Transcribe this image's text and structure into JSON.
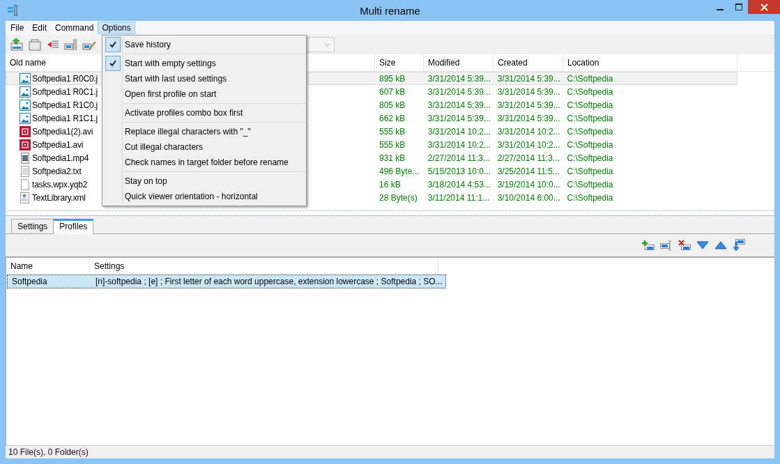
{
  "window": {
    "title": "Multi rename"
  },
  "menubar": [
    {
      "label": "File",
      "selected": false
    },
    {
      "label": "Edit",
      "selected": false
    },
    {
      "label": "Command",
      "selected": false
    },
    {
      "label": "Options",
      "selected": true
    }
  ],
  "options_menu": {
    "groups": [
      [
        {
          "label": "Save history",
          "checked": true
        }
      ],
      [
        {
          "label": "Start with empty settings",
          "checked": true
        },
        {
          "label": "Start with last used settings",
          "checked": false
        },
        {
          "label": "Open first profile on start",
          "checked": false
        }
      ],
      [
        {
          "label": "Activate profiles combo box first",
          "checked": false
        }
      ],
      [
        {
          "label": "Replace illegal characters with \"_\"",
          "checked": false
        },
        {
          "label": "Cut illegal characters",
          "checked": false
        },
        {
          "label": "Check names in target folder before rename",
          "checked": false
        }
      ],
      [
        {
          "label": "Stay on top",
          "checked": false
        },
        {
          "label": "Quick viewer orientation - horizontal",
          "checked": false
        }
      ]
    ]
  },
  "files": {
    "columns": [
      "Old name",
      "Size",
      "Modified",
      "Created",
      "Location"
    ],
    "rows": [
      {
        "kind": "image",
        "name": "Softpedia1 R0C0.j",
        "size": "895 kB",
        "modified": "3/31/2014 5:39...",
        "created": "3/31/2014 5:39...",
        "location": "C:\\Softpedia",
        "selected": true
      },
      {
        "kind": "image",
        "name": "Softpedia1 R0C1.j",
        "size": "607 kB",
        "modified": "3/31/2014 5:39...",
        "created": "3/31/2014 5:39...",
        "location": "C:\\Softpedia",
        "selected": false
      },
      {
        "kind": "image",
        "name": "Softpedia1 R1C0.j",
        "size": "805 kB",
        "modified": "3/31/2014 5:39...",
        "created": "3/31/2014 5:39...",
        "location": "C:\\Softpedia",
        "selected": false
      },
      {
        "kind": "image",
        "name": "Softpedia1 R1C1.j",
        "size": "662 kB",
        "modified": "3/31/2014 5:39...",
        "created": "3/31/2014 5:39...",
        "location": "C:\\Softpedia",
        "selected": false
      },
      {
        "kind": "video",
        "name": "Softpedia1(2).avi",
        "size": "555 kB",
        "modified": "3/31/2014 10:2...",
        "created": "3/31/2014 10:2...",
        "location": "C:\\Softpedia",
        "selected": false
      },
      {
        "kind": "video",
        "name": "Softpedia1.avi",
        "size": "555 kB",
        "modified": "3/31/2014 10:2...",
        "created": "3/31/2014 10:2...",
        "location": "C:\\Softpedia",
        "selected": false
      },
      {
        "kind": "film",
        "name": "Softpedia1.mp4",
        "size": "931 kB",
        "modified": "2/27/2014 11:3...",
        "created": "2/27/2014 11:3...",
        "location": "C:\\Softpedia",
        "selected": false
      },
      {
        "kind": "text",
        "name": "Softpedia2.txt",
        "size": "496 Byte...",
        "modified": "5/15/2013 10:0...",
        "created": "3/25/2014 11:5...",
        "location": "C:\\Softpedia",
        "selected": false
      },
      {
        "kind": "blank",
        "name": "tasks.wpx.yqb2",
        "size": "16 kB",
        "modified": "3/18/2014 4:53...",
        "created": "3/19/2014 10:0...",
        "location": "C:\\Softpedia",
        "selected": false
      },
      {
        "kind": "xml",
        "name": "TextLibrary.xml",
        "size": "28 Byte(s)",
        "modified": "3/11/2014 11:1...",
        "created": "3/10/2014 6:00...",
        "location": "C:\\Softpedia",
        "selected": false
      }
    ]
  },
  "tabs": [
    {
      "label": "Settings",
      "selected": false
    },
    {
      "label": "Profiles",
      "selected": true
    }
  ],
  "profiles": {
    "columns": [
      "Name",
      "Settings"
    ],
    "rows": [
      {
        "name": "Softpedia",
        "settings": "[n]-softpedia ; [e] ; First letter of each word uppercase, extension lowercase ; Softpedia ; SO...",
        "selected": true
      }
    ]
  },
  "status_bar": "10 File(s), 0 Folder(s)"
}
